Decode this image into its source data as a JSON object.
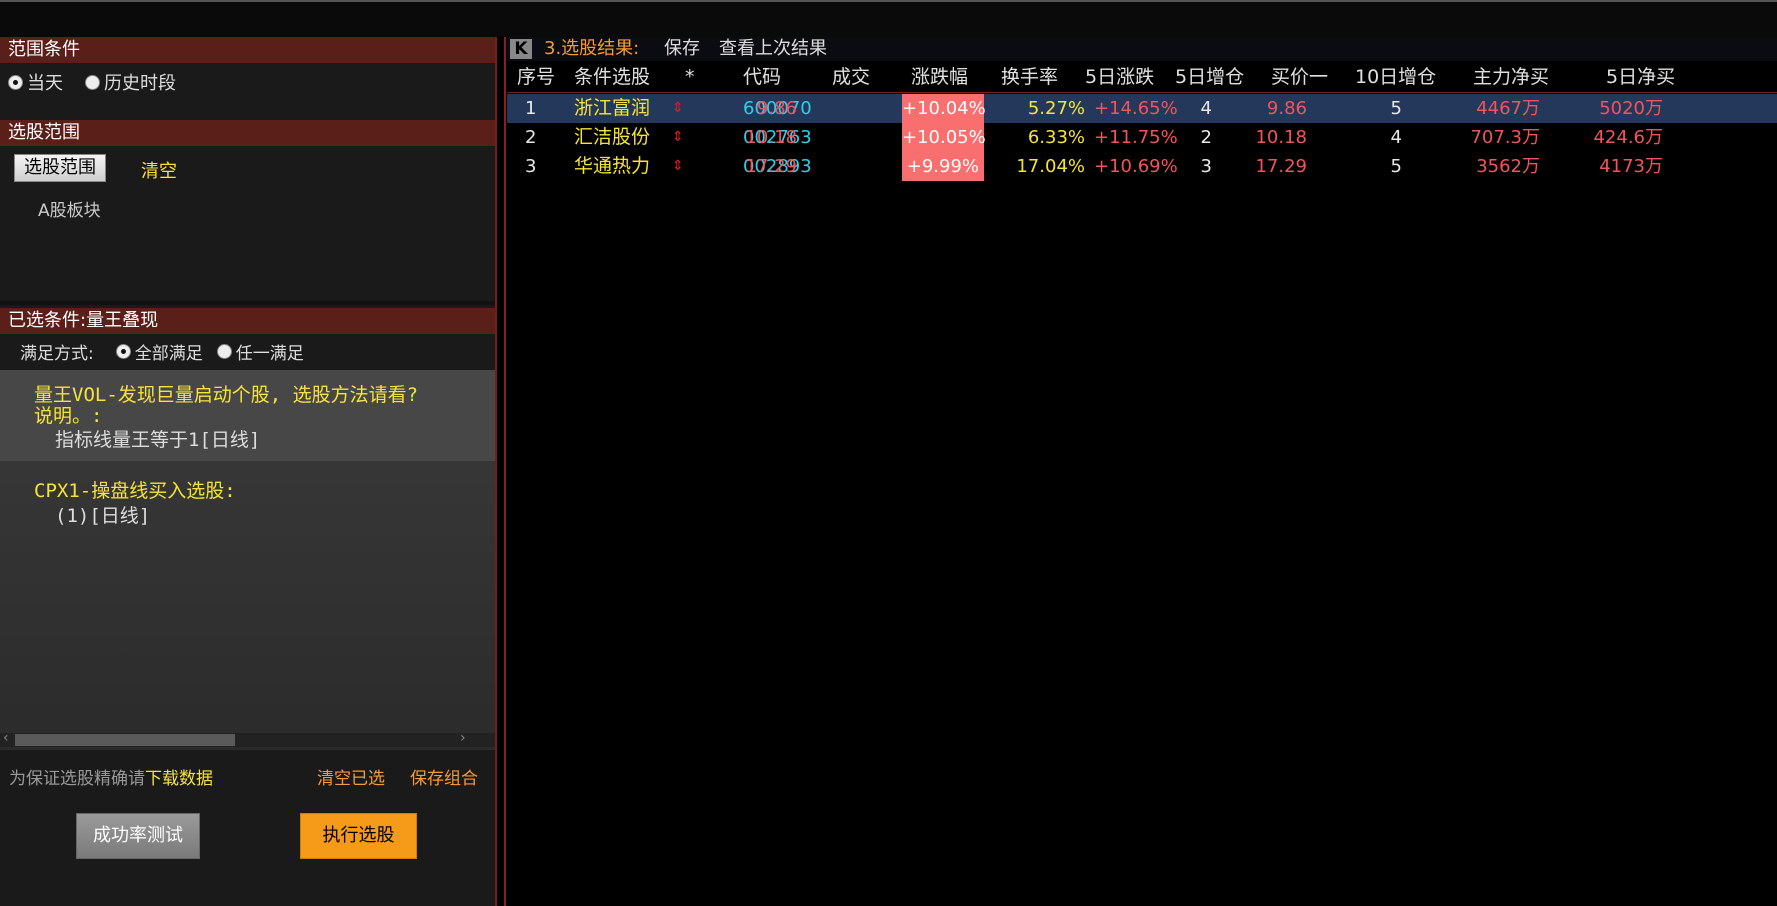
{
  "left": {
    "range_cond": {
      "title": "范围条件",
      "opt_today": "当天",
      "opt_history": "历史时段"
    },
    "stock_range": {
      "title": "选股范围",
      "btn_select": "选股范围",
      "btn_clear": "清空",
      "item": "A股板块"
    },
    "selected": {
      "title": "已选条件:量王叠现",
      "mode_label": "满足方式:",
      "mode_all": "全部满足",
      "mode_any": "任一满足",
      "c1_line1": "量王VOL-发现巨量启动个股, 选股方法请看?",
      "c1_line2": "说明。:",
      "c1_line3": "指标线量王等于1[日线]",
      "c2_line1": "CPX1-操盘线买入选股:",
      "c2_line2": "(1)[日线]"
    },
    "bottom": {
      "hint": "为保证选股精确请",
      "download": "下载数据",
      "clear_selected": "清空已选",
      "save_combo": "保存组合",
      "btn_test": "成功率测试",
      "btn_run": "执行选股"
    }
  },
  "right": {
    "toolbar": {
      "k_label": "K",
      "title": "3.选股结果:",
      "save": "保存",
      "view_last": "查看上次结果"
    },
    "headers": [
      "序号",
      "条件选股",
      "*",
      "代码",
      "成交",
      "涨跌幅",
      "换手率",
      "5日涨跌",
      "5日增仓",
      "买价一",
      "10日增仓",
      "主力净买",
      "5日净买"
    ],
    "rows": [
      {
        "idx": "1",
        "name": "浙江富润",
        "code": "600070",
        "price": "9.86",
        "pct": "+10.04%",
        "turnover": "5.27%",
        "chg5": "+14.65%",
        "add5": "4",
        "bid1": "9.86",
        "add10": "5",
        "net_main": "4467万",
        "net5": "5020万"
      },
      {
        "idx": "2",
        "name": "汇洁股份",
        "code": "002763",
        "price": "10.18",
        "pct": "+10.05%",
        "turnover": "6.33%",
        "chg5": "+11.75%",
        "add5": "2",
        "bid1": "10.18",
        "add10": "4",
        "net_main": "707.3万",
        "net5": "424.6万"
      },
      {
        "idx": "3",
        "name": "华通热力",
        "code": "002893",
        "price": "17.29",
        "pct": "+9.99%",
        "turnover": "17.04%",
        "chg5": "+10.69%",
        "add5": "3",
        "bid1": "17.29",
        "add10": "5",
        "net_main": "3562万",
        "net5": "4173万"
      }
    ],
    "arrow_icon": "up-down-arrow-icon"
  }
}
